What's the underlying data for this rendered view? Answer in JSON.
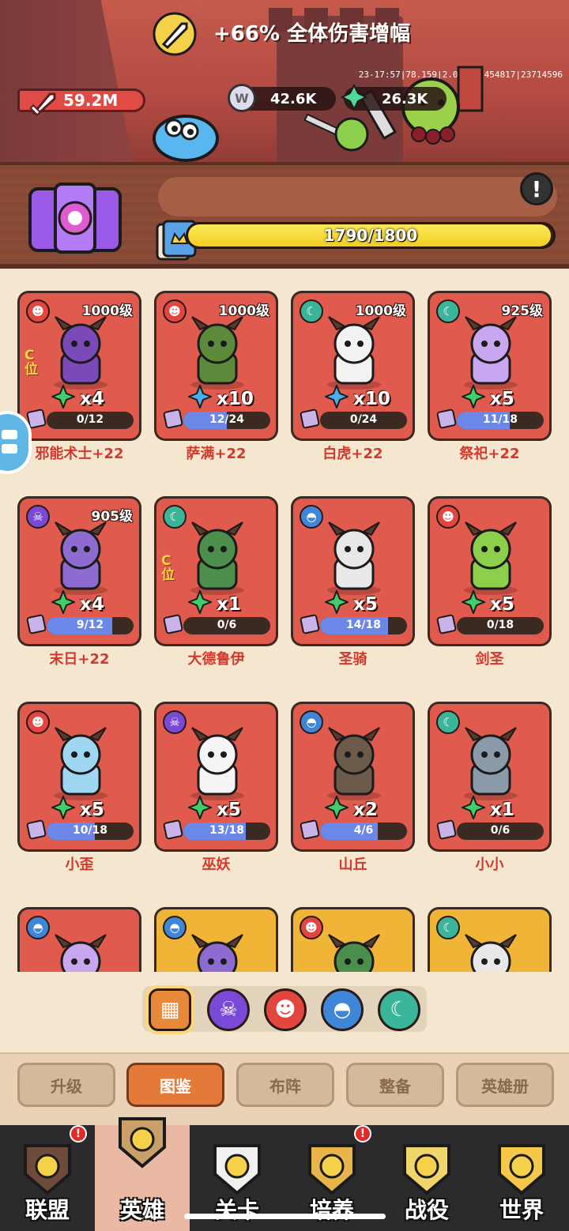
{
  "header": {
    "attack_power": "59.2M",
    "coins": "42.6K",
    "gems": "26.3K",
    "debug_info": "23-17:57|78.159|2.0.430|454817|23714596"
  },
  "collection": {
    "bonus_text": "+66% 全体伤害增幅",
    "progress_text": "1790/1800",
    "progress_fraction": 0.9944
  },
  "heroes": [
    {
      "name": "邪能术士+22",
      "level": "1000级",
      "faction": "red",
      "stars": "x4",
      "star_color": "green",
      "fragments": "0/12",
      "fraction": 0.0,
      "badge": "C位"
    },
    {
      "name": "萨满+22",
      "level": "1000级",
      "faction": "red",
      "stars": "x10",
      "star_color": "blue",
      "fragments": "12/24",
      "fraction": 0.5,
      "badge": ""
    },
    {
      "name": "白虎+22",
      "level": "1000级",
      "faction": "teal",
      "stars": "x10",
      "star_color": "blue",
      "fragments": "0/24",
      "fraction": 0.0,
      "badge": ""
    },
    {
      "name": "祭祀+22",
      "level": "925级",
      "faction": "teal",
      "stars": "x5",
      "star_color": "green",
      "fragments": "11/18",
      "fraction": 0.611,
      "badge": ""
    },
    {
      "name": "末日+22",
      "level": "905级",
      "faction": "purple",
      "stars": "x4",
      "star_color": "green",
      "fragments": "9/12",
      "fraction": 0.75,
      "badge": ""
    },
    {
      "name": "大德鲁伊",
      "level": "",
      "faction": "teal",
      "stars": "x1",
      "star_color": "green",
      "fragments": "0/6",
      "fraction": 0.0,
      "badge": "C位"
    },
    {
      "name": "圣骑",
      "level": "",
      "faction": "blue",
      "stars": "x5",
      "star_color": "green",
      "fragments": "14/18",
      "fraction": 0.778,
      "badge": ""
    },
    {
      "name": "剑圣",
      "level": "",
      "faction": "red",
      "stars": "x5",
      "star_color": "green",
      "fragments": "0/18",
      "fraction": 0.0,
      "badge": ""
    },
    {
      "name": "小歪",
      "level": "",
      "faction": "red",
      "stars": "x5",
      "star_color": "green",
      "fragments": "10/18",
      "fraction": 0.556,
      "badge": ""
    },
    {
      "name": "巫妖",
      "level": "",
      "faction": "purple",
      "stars": "x5",
      "star_color": "green",
      "fragments": "13/18",
      "fraction": 0.722,
      "badge": ""
    },
    {
      "name": "山丘",
      "level": "",
      "faction": "blue",
      "stars": "x2",
      "star_color": "green",
      "fragments": "4/6",
      "fraction": 0.667,
      "badge": ""
    },
    {
      "name": "小小",
      "level": "",
      "faction": "teal",
      "stars": "x1",
      "star_color": "green",
      "fragments": "0/6",
      "fraction": 0.0,
      "badge": ""
    }
  ],
  "partial_heroes": [
    {
      "faction": "blue",
      "rarity": "red"
    },
    {
      "faction": "blue",
      "rarity": "gold"
    },
    {
      "faction": "red",
      "rarity": "gold"
    },
    {
      "faction": "teal",
      "rarity": "gold"
    }
  ],
  "faction_filters": [
    {
      "icon": "all-factions-icon",
      "active": true
    },
    {
      "icon": "skull-icon",
      "active": false
    },
    {
      "icon": "demon-mask-icon",
      "active": false
    },
    {
      "icon": "helmet-icon",
      "active": false
    },
    {
      "icon": "crescent-moon-icon",
      "active": false
    }
  ],
  "sub_tabs": [
    "升级",
    "图鉴",
    "布阵",
    "整备",
    "英雄册"
  ],
  "active_sub_tab": "图鉴",
  "bottom_nav": [
    {
      "label": "联盟",
      "icon": "crown-shield-icon",
      "alert": true
    },
    {
      "label": "英雄",
      "icon": "hero-swirl-icon",
      "alert": false
    },
    {
      "label": "关卡",
      "icon": "sword-icon",
      "alert": false
    },
    {
      "label": "培养",
      "icon": "eye-gem-icon",
      "alert": true
    },
    {
      "label": "战役",
      "icon": "banner-icon",
      "alert": false
    },
    {
      "label": "世界",
      "icon": "world-tree-icon",
      "alert": false
    }
  ],
  "active_nav": "英雄",
  "colors": {
    "card_red": "#e05a4e",
    "card_gold": "#f0b437",
    "accent_orange": "#e47a3a",
    "progress_yellow": "#ffe95a",
    "fragment_blue": "#6b87e8"
  }
}
